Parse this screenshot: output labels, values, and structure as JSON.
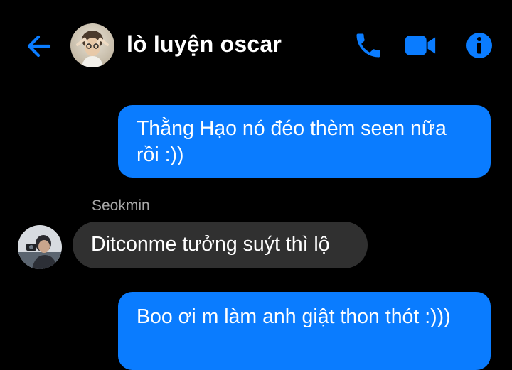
{
  "header": {
    "contact_name": "lò luyện oscar",
    "accent_color": "#0a7cff",
    "icons": {
      "back": "arrow-left-icon",
      "call": "phone-icon",
      "video": "video-camera-icon",
      "info": "info-icon"
    }
  },
  "messages": [
    {
      "direction": "outgoing",
      "text": "Thằng Hạo nó đéo thèm seen nữa rồi :))"
    },
    {
      "direction": "incoming",
      "sender": "Seokmin",
      "text": "Ditconme tưởng suýt thì lộ"
    },
    {
      "direction": "outgoing",
      "text": "Boo ơi m làm anh giật thon thót :)))"
    }
  ],
  "colors": {
    "background": "#000000",
    "outgoing_bubble": "#0a7cff",
    "incoming_bubble": "#303030",
    "sender_label": "#a8a8a8"
  }
}
